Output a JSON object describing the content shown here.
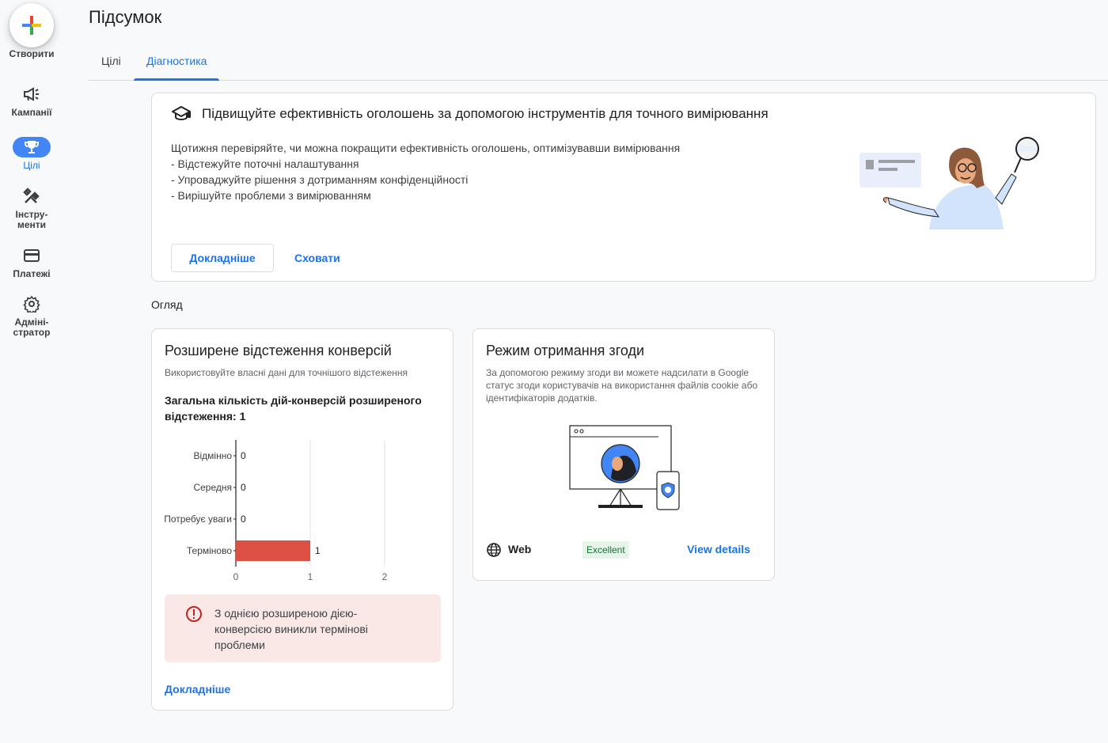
{
  "rail": {
    "create_label": "Створити",
    "items": [
      {
        "label": "Кампанії",
        "icon": "megaphone-icon"
      },
      {
        "label": "Цілі",
        "icon": "trophy-icon"
      },
      {
        "label": "Інстру-",
        "label2": "менти",
        "icon": "tools-icon"
      },
      {
        "label": "Платежі",
        "icon": "credit-card-icon"
      },
      {
        "label": "Адміні-",
        "label2": "стратор",
        "icon": "gear-icon"
      }
    ]
  },
  "header": {
    "title": "Підсумок",
    "tabs": [
      {
        "label": "Цілі"
      },
      {
        "label": "Діагностика",
        "active": true
      }
    ]
  },
  "promo": {
    "title": "Підвищуйте ефективність оголошень за допомогою інструментів для точного вимірювання",
    "line1": "Щотижня перевіряйте, чи можна покращити ефективність оголошень, оптимізувавши вимірювання",
    "line2": "- Відстежуйте поточні налаштування",
    "line3": "- Упроваджуйте рішення з дотриманням конфіденційності",
    "line4": "- Вирішуйте проблеми з вимірюванням",
    "learn_more": "Докладніше",
    "hide": "Сховати"
  },
  "overview_label": "Огляд",
  "conversions_card": {
    "title": "Розширене відстеження конверсій",
    "subtitle": "Використовуйте власні дані для точнішого відстеження",
    "metric": "Загальна кількість дій-конверсій розширеного відстеження: 1",
    "alert": "З однією розширеною дією-конверсією виникли термінові проблеми",
    "learn_more": "Докладніше"
  },
  "chart_data": {
    "type": "bar",
    "orientation": "horizontal",
    "categories": [
      "Відмінно",
      "Середня",
      "Потребує уваги",
      "Терміново"
    ],
    "values": [
      0,
      0,
      0,
      1
    ],
    "xlim": [
      0,
      2
    ],
    "xticks": [
      "0",
      "1",
      "2"
    ],
    "bar_color": "#dd5144",
    "grid": true
  },
  "consent_card": {
    "title": "Режим отримання згоди",
    "description": "За допомогою режиму згоди ви можете надсилати в Google статус згоди користувачів на використання файлів cookie або ідентифікаторів додатків.",
    "platform": "Web",
    "status": "Excellent",
    "view_details": "View details"
  },
  "colors": {
    "accent": "#1a73e8",
    "alert_bg": "#fae8e6",
    "badge_bg": "#e6f4ea",
    "badge_text": "#137333"
  }
}
